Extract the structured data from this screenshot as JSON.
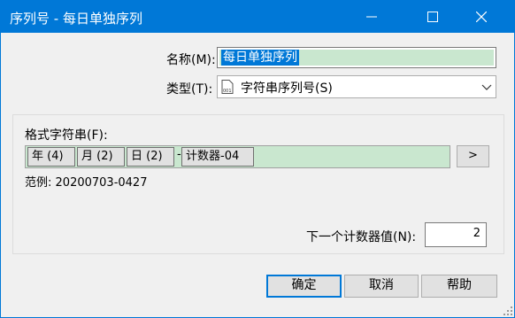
{
  "window": {
    "title": "序列号 - 每日单独序列",
    "title_bg": "#0078d7",
    "controls": [
      "minimize-icon",
      "maximize-icon",
      "close-icon"
    ]
  },
  "form": {
    "name_label": "名称(M):",
    "name_value": "每日单独序列",
    "type_label": "类型(T):",
    "type_value": "字符串序列号(S)",
    "type_icon": "document-icon"
  },
  "format": {
    "label": "格式字符串(F):",
    "tokens": [
      "年 (4)",
      "月 (2)",
      "日 (2)",
      "计数器-04"
    ],
    "separator": "-",
    "insert_button": ">",
    "example_label": "范例:",
    "example_value": "20200703-0427"
  },
  "counter": {
    "label": "下一个计数器值(N):",
    "value": "2"
  },
  "buttons": {
    "ok": "确定",
    "cancel": "取消",
    "help": "帮助"
  },
  "colors": {
    "accent": "#0078d7",
    "highlight": "#c9e7cf"
  }
}
